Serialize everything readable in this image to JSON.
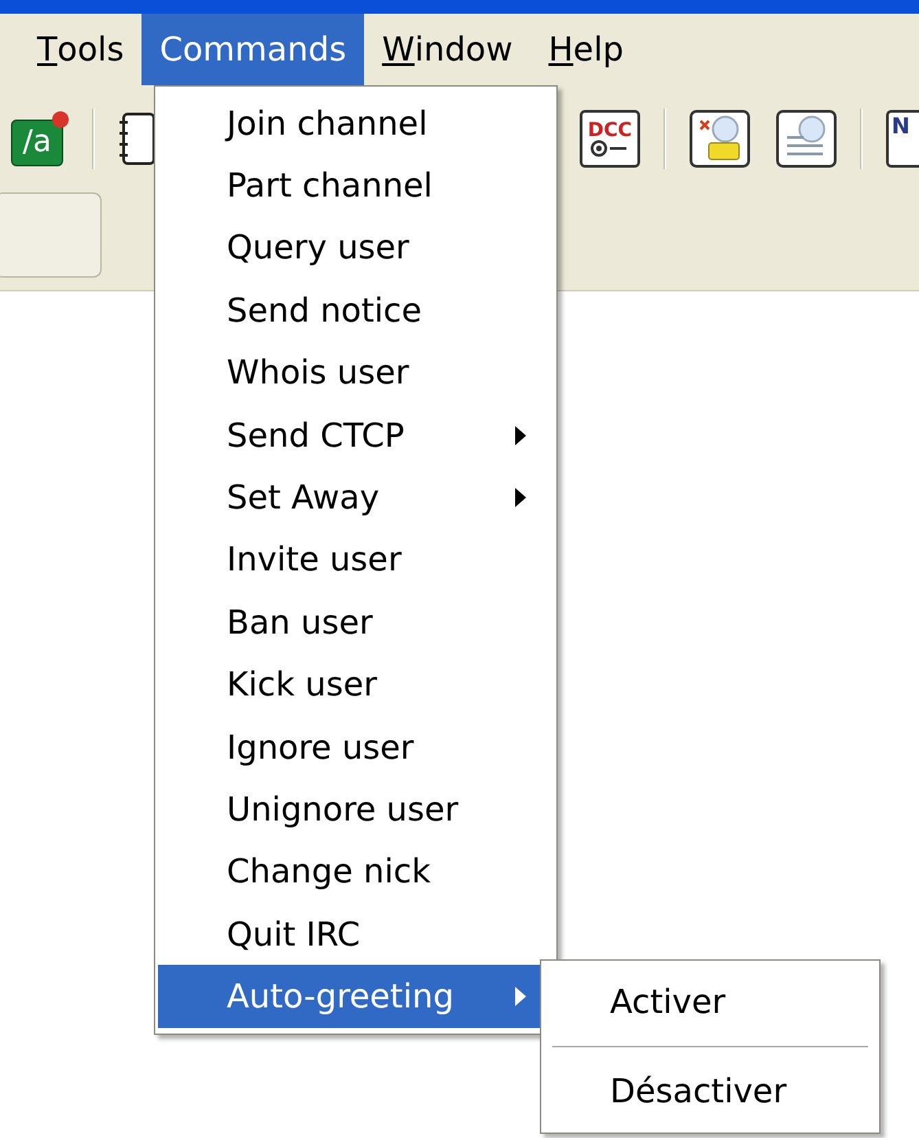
{
  "menu_bar": [
    {
      "label": "Tools",
      "underline_first": true,
      "selected": false
    },
    {
      "label": "Commands",
      "underline_first": false,
      "selected": true
    },
    {
      "label": "Window",
      "underline_first": true,
      "selected": false
    },
    {
      "label": "Help",
      "underline_first": true,
      "selected": false
    }
  ],
  "toolbar": [
    {
      "kind": "slash",
      "label": "/a"
    },
    {
      "kind": "separator"
    },
    {
      "kind": "notepad"
    },
    {
      "kind": "dcc",
      "label": "DCC"
    },
    {
      "kind": "separator"
    },
    {
      "kind": "folder"
    },
    {
      "kind": "list"
    },
    {
      "kind": "separator"
    },
    {
      "kind": "page",
      "label": "N"
    }
  ],
  "commands_menu": [
    {
      "label": "Join channel",
      "submenu": false,
      "selected": false
    },
    {
      "label": "Part channel",
      "submenu": false,
      "selected": false
    },
    {
      "label": "Query user",
      "submenu": false,
      "selected": false
    },
    {
      "label": "Send notice",
      "submenu": false,
      "selected": false
    },
    {
      "label": "Whois user",
      "submenu": false,
      "selected": false
    },
    {
      "label": "Send CTCP",
      "submenu": true,
      "selected": false
    },
    {
      "label": "Set Away",
      "submenu": true,
      "selected": false
    },
    {
      "label": "Invite user",
      "submenu": false,
      "selected": false
    },
    {
      "label": "Ban user",
      "submenu": false,
      "selected": false
    },
    {
      "label": "Kick user",
      "submenu": false,
      "selected": false
    },
    {
      "label": "Ignore user",
      "submenu": false,
      "selected": false
    },
    {
      "label": "Unignore user",
      "submenu": false,
      "selected": false
    },
    {
      "label": "Change nick",
      "submenu": false,
      "selected": false
    },
    {
      "label": "Quit IRC",
      "submenu": false,
      "selected": false
    },
    {
      "label": "Auto-greeting",
      "submenu": true,
      "selected": true
    }
  ],
  "submenu": [
    {
      "kind": "item",
      "label": "Activer"
    },
    {
      "kind": "separator"
    },
    {
      "kind": "item",
      "label": "Désactiver"
    }
  ]
}
